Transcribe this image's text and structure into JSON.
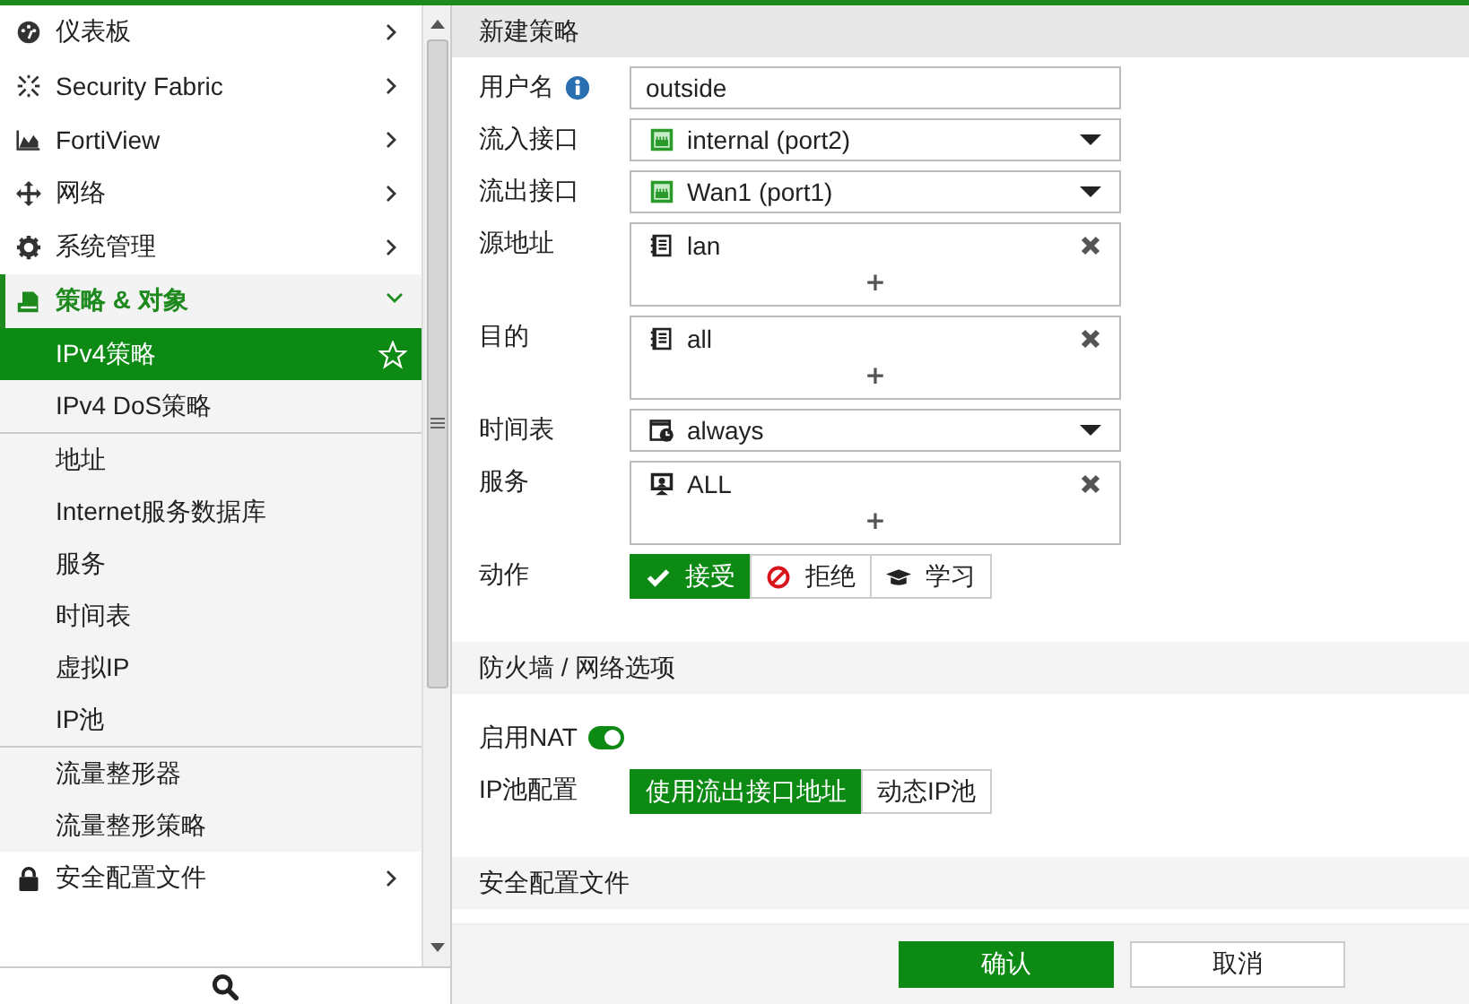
{
  "sidebar": {
    "items": [
      {
        "label": "仪表板",
        "kind": "dashboard",
        "expanded": false,
        "selected": false
      },
      {
        "label": "Security Fabric",
        "kind": "fabric",
        "expanded": false,
        "selected": false
      },
      {
        "label": "FortiView",
        "kind": "chart",
        "expanded": false,
        "selected": false
      },
      {
        "label": "网络",
        "kind": "network",
        "expanded": false,
        "selected": false
      },
      {
        "label": "系统管理",
        "kind": "gear",
        "expanded": false,
        "selected": false
      },
      {
        "label": "策略 & 对象",
        "kind": "policy",
        "expanded": true,
        "selected": false,
        "children": [
          {
            "label": "IPv4策略",
            "selected": true,
            "separated": false
          },
          {
            "label": "IPv4 DoS策略",
            "selected": false,
            "separated": false
          },
          {
            "label": "地址",
            "selected": false,
            "separated": true
          },
          {
            "label": "Internet服务数据库",
            "selected": false,
            "separated": false
          },
          {
            "label": "服务",
            "selected": false,
            "separated": false
          },
          {
            "label": "时间表",
            "selected": false,
            "separated": false
          },
          {
            "label": "虚拟IP",
            "selected": false,
            "separated": false
          },
          {
            "label": "IP池",
            "selected": false,
            "separated": false
          },
          {
            "label": "流量整形器",
            "selected": false,
            "separated": true
          },
          {
            "label": "流量整形策略",
            "selected": false,
            "separated": false
          }
        ]
      },
      {
        "label": "安全配置文件",
        "kind": "lock",
        "expanded": false,
        "selected": false
      }
    ]
  },
  "sections": [
    {
      "title": "新建策略",
      "fields": [
        {
          "kind": "text",
          "label": "用户名",
          "info": true,
          "value": "outside"
        },
        {
          "kind": "select",
          "label": "流入接口",
          "entry": {
            "kind": "port",
            "text": "internal (port2)"
          }
        },
        {
          "kind": "select",
          "label": "流出接口",
          "entry": {
            "kind": "port",
            "text": "Wan1 (port1)"
          }
        },
        {
          "kind": "multi",
          "label": "源地址",
          "entries": [
            {
              "kind": "address",
              "text": "lan"
            }
          ],
          "add": "+"
        },
        {
          "kind": "multi",
          "label": "目的",
          "entries": [
            {
              "kind": "address",
              "text": "all"
            }
          ],
          "add": "+"
        },
        {
          "kind": "select",
          "label": "时间表",
          "entry": {
            "kind": "schedule",
            "text": "always"
          }
        },
        {
          "kind": "multi",
          "label": "服务",
          "entries": [
            {
              "kind": "service",
              "text": "ALL"
            }
          ],
          "add": "+"
        },
        {
          "kind": "segmented",
          "label": "动作",
          "options": [
            {
              "label": "接受",
              "kind": "check",
              "selected": true
            },
            {
              "label": "拒绝",
              "kind": "deny",
              "selected": false
            },
            {
              "label": "学习",
              "kind": "learn",
              "selected": false
            }
          ]
        }
      ]
    },
    {
      "title": "防火墙 / 网络选项",
      "fields": [
        {
          "kind": "toggle",
          "label": "启用NAT",
          "on": true
        },
        {
          "kind": "segmented",
          "label": "IP池配置",
          "options": [
            {
              "label": "使用流出接口地址",
              "selected": true
            },
            {
              "label": "动态IP池",
              "selected": false
            }
          ]
        }
      ]
    },
    {
      "title": "安全配置文件"
    }
  ],
  "footer": {
    "buttons": [
      {
        "label": "确认",
        "primary": true
      },
      {
        "label": "取消",
        "primary": false
      }
    ]
  }
}
